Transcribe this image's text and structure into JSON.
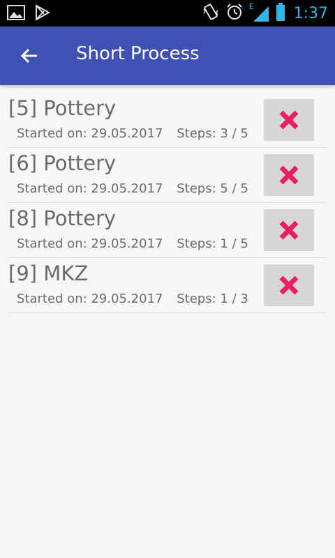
{
  "status_bar": {
    "time": "1:37",
    "network_label": "E",
    "icons": [
      "gallery-icon",
      "play-store-icon",
      "vibrate-icon",
      "alarm-icon",
      "signal-icon",
      "battery-icon"
    ],
    "accent_color": "#33b5e5"
  },
  "app_bar": {
    "title": "Short Process",
    "back_icon": "arrow-left-icon",
    "color": "#3f51b5"
  },
  "processes": [
    {
      "title": "[5] Pottery",
      "started_label": "Started on:",
      "started_date": "29.05.2017",
      "steps_label": "Steps:",
      "steps": "3 / 5",
      "delete_icon": "close-icon"
    },
    {
      "title": "[6] Pottery",
      "started_label": "Started on:",
      "started_date": "29.05.2017",
      "steps_label": "Steps:",
      "steps": "5 / 5",
      "delete_icon": "close-icon"
    },
    {
      "title": "[8] Pottery",
      "started_label": "Started on:",
      "started_date": "29.05.2017",
      "steps_label": "Steps:",
      "steps": "1 / 5",
      "delete_icon": "close-icon"
    },
    {
      "title": "[9] MKZ",
      "started_label": "Started on:",
      "started_date": "29.05.2017",
      "steps_label": "Steps:",
      "steps": "1 / 3",
      "delete_icon": "close-icon"
    }
  ],
  "delete_icon_color": "#e91e63"
}
